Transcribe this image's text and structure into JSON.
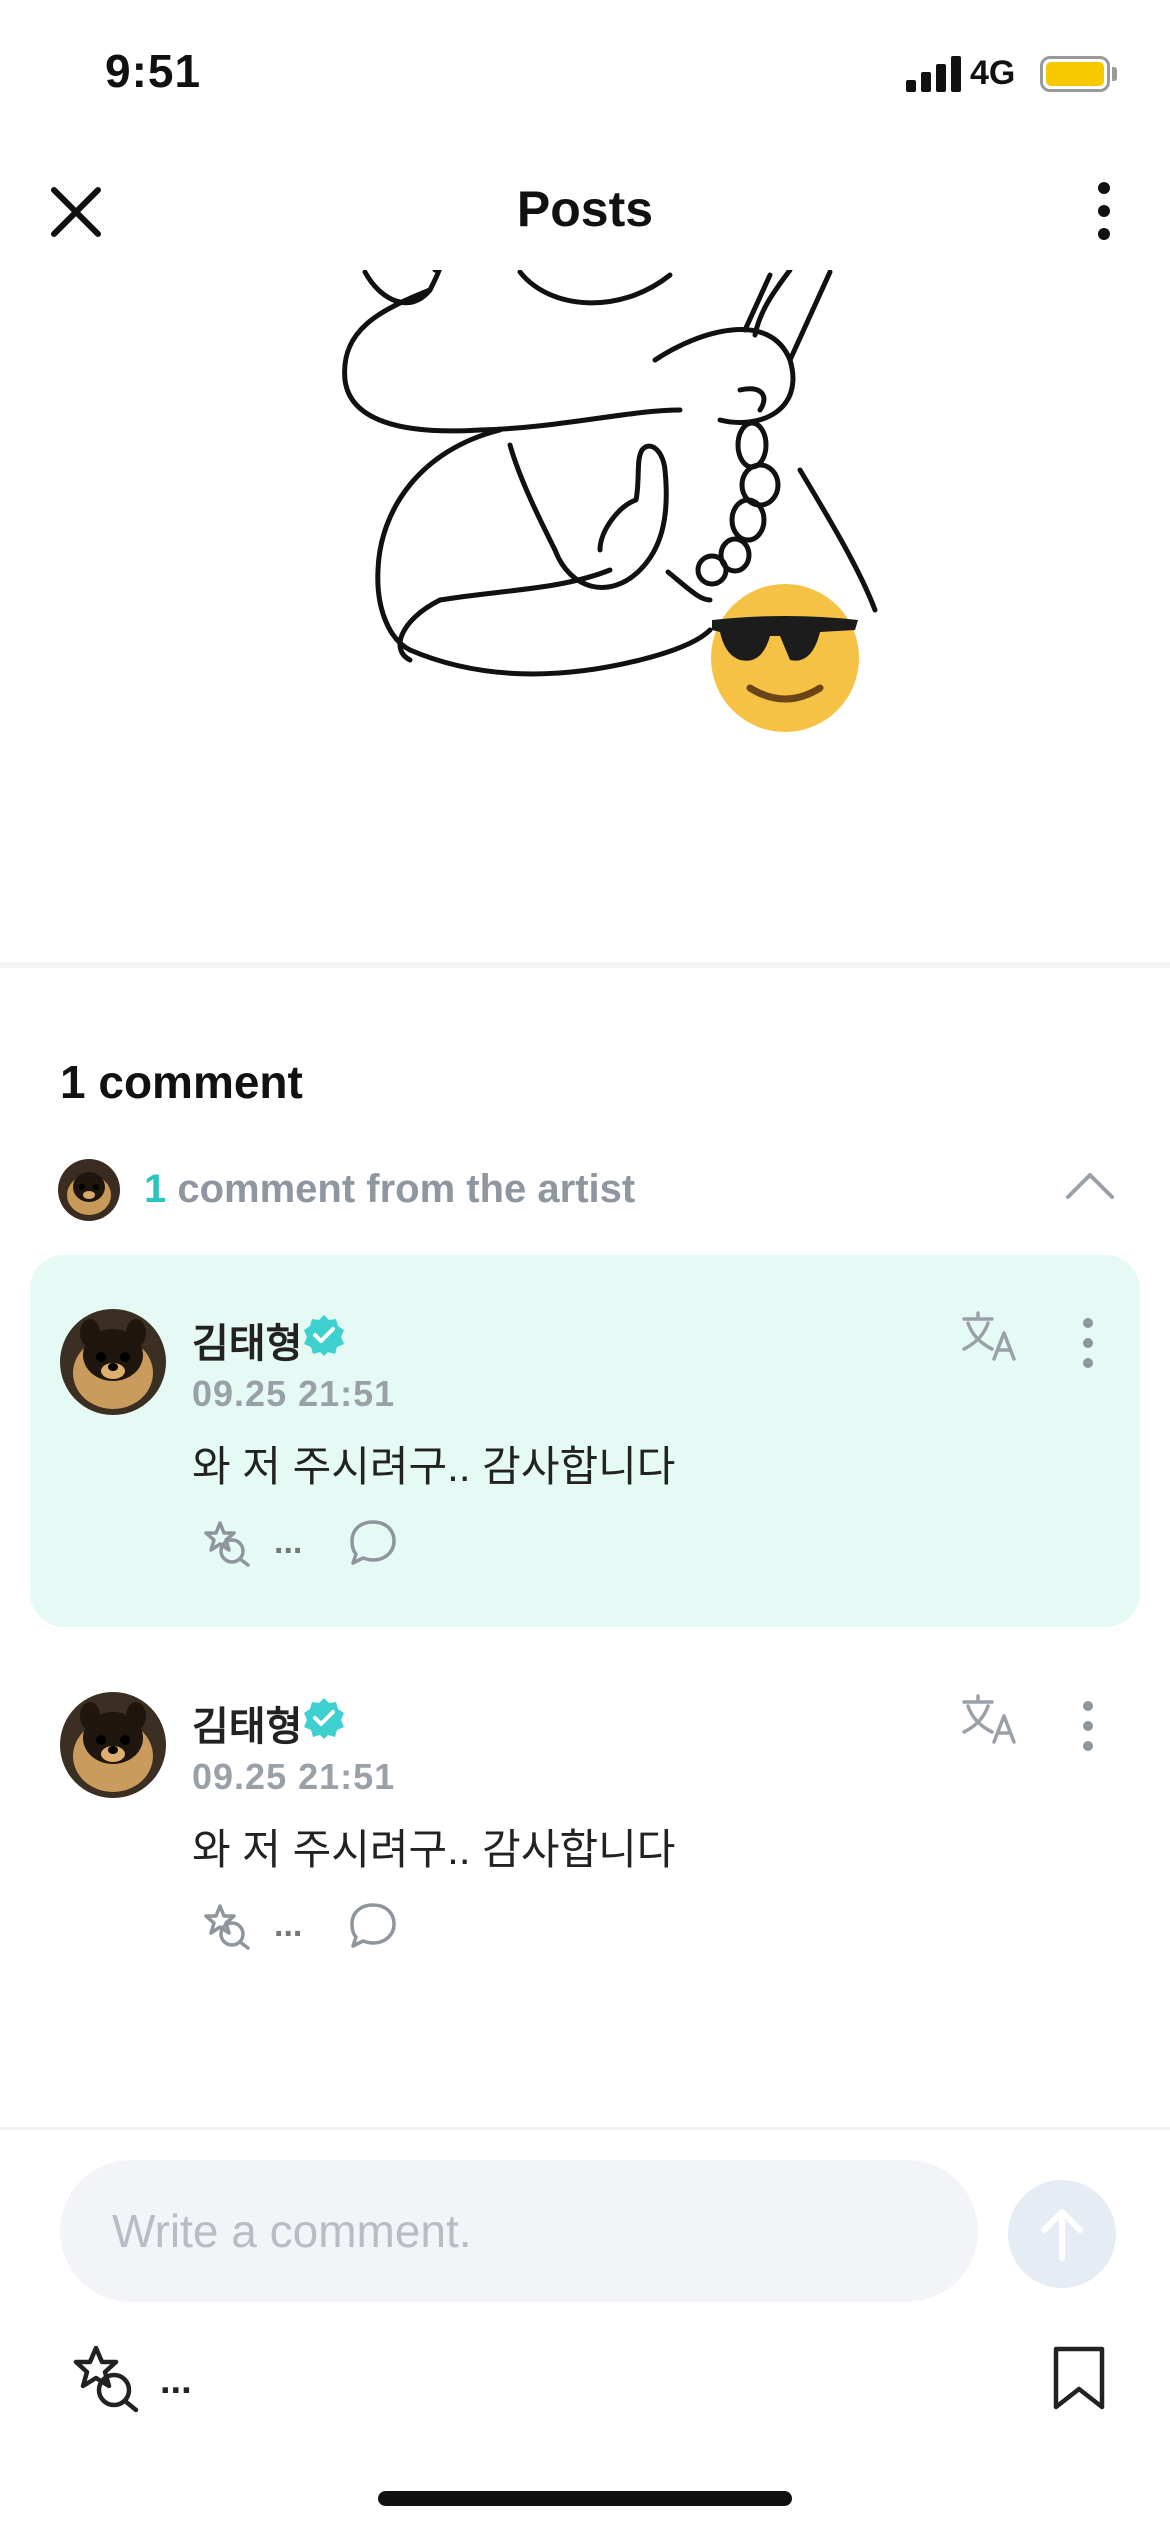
{
  "status_bar": {
    "time": "9:51",
    "network": "4G",
    "battery_color": "#f5c800"
  },
  "nav": {
    "title": "Posts",
    "close_icon": "close-icon",
    "more_icon": "more-vertical-icon"
  },
  "post": {
    "image_icon": "illustration-thumbs-up-sunglasses-emoji"
  },
  "comments_section": {
    "count_label": "1 comment",
    "artist_row": {
      "count": "1",
      "label": " comment from the artist",
      "accent": "#2cc4c0"
    }
  },
  "comments": [
    {
      "author": "김태형",
      "date": "09.25 21:51",
      "text": "와 저 주시려구.. 감사합니다",
      "like_count": "...",
      "highlighted": true
    },
    {
      "author": "김태형",
      "date": "09.25 21:51",
      "text": "와 저 주시려구.. 감사합니다",
      "like_count": "...",
      "highlighted": false
    }
  ],
  "composer": {
    "placeholder": "Write a comment.",
    "like_count": "..."
  },
  "colors": {
    "highlight_bg": "#e6faf5",
    "verified": "#2cc4c0"
  }
}
